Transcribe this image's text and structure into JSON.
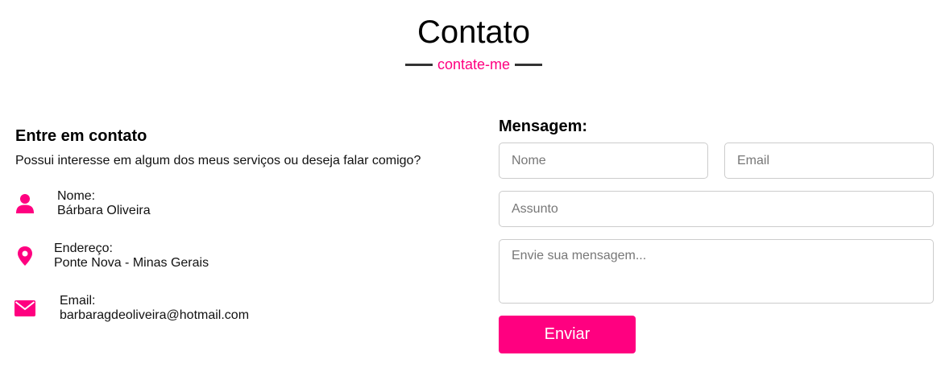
{
  "header": {
    "title": "Contato",
    "subtitle": "contate-me"
  },
  "info": {
    "heading": "Entre em contato",
    "description": "Possui interesse em algum dos meus serviços ou deseja falar comigo?",
    "items": [
      {
        "icon": "user-icon",
        "label": "Nome:",
        "value": "Bárbara Oliveira"
      },
      {
        "icon": "map-pin-icon",
        "label": "Endereço:",
        "value": "Ponte Nova - Minas Gerais"
      },
      {
        "icon": "envelope-icon",
        "label": "Email:",
        "value": "barbaragdeoliveira@hotmail.com"
      }
    ]
  },
  "form": {
    "heading": "Mensagem:",
    "name_placeholder": "Nome",
    "email_placeholder": "Email",
    "subject_placeholder": "Assunto",
    "message_placeholder": "Envie sua mensagem...",
    "submit_label": "Enviar"
  },
  "colors": {
    "accent": "#ff0080",
    "line": "#333333",
    "border": "#cccccc"
  }
}
